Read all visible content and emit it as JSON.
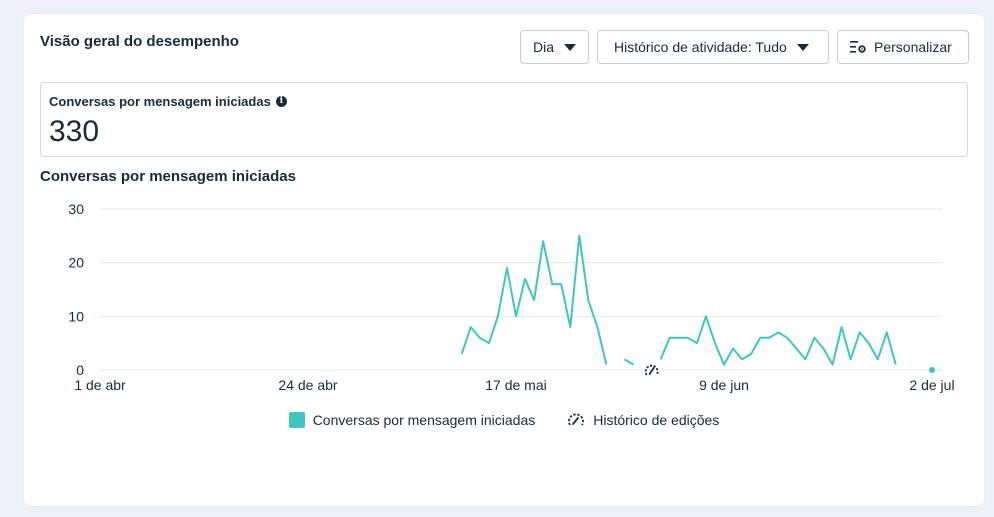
{
  "card": {
    "title": "Visão geral do desempenho",
    "period_select": "Dia",
    "history_select": "Histórico de atividade: Tudo",
    "customize_label": "Personalizar"
  },
  "metric": {
    "label": "Conversas por mensagem iniciadas",
    "value": "330"
  },
  "colors": {
    "series": "#3ec7c2",
    "grid": "#e4e6eb",
    "text": "#1c2b33"
  },
  "chart_data": {
    "type": "line",
    "title": "Conversas por mensagem iniciadas",
    "xlabel": "",
    "ylabel": "",
    "ylim": [
      0,
      30
    ],
    "yticks": [
      0,
      10,
      20,
      30
    ],
    "xlim": [
      "2024-04-01",
      "2024-07-02"
    ],
    "xticks": [
      {
        "date": "2024-04-01",
        "label": "1 de abr"
      },
      {
        "date": "2024-04-24",
        "label": "24 de abr"
      },
      {
        "date": "2024-05-17",
        "label": "17 de mai"
      },
      {
        "date": "2024-06-09",
        "label": "9 de jun"
      },
      {
        "date": "2024-07-02",
        "label": "2 de jul"
      }
    ],
    "grid": true,
    "legend_position": "bottom",
    "series": [
      {
        "name": "Conversas por mensagem iniciadas",
        "segments": [
          [
            [
              "2024-05-11",
              3
            ],
            [
              "2024-05-12",
              8
            ],
            [
              "2024-05-13",
              6
            ],
            [
              "2024-05-14",
              5
            ],
            [
              "2024-05-15",
              10
            ],
            [
              "2024-05-16",
              19
            ],
            [
              "2024-05-17",
              10
            ],
            [
              "2024-05-18",
              17
            ],
            [
              "2024-05-19",
              13
            ],
            [
              "2024-05-20",
              24
            ],
            [
              "2024-05-21",
              16
            ],
            [
              "2024-05-22",
              16
            ],
            [
              "2024-05-23",
              8
            ],
            [
              "2024-05-24",
              25
            ],
            [
              "2024-05-25",
              13
            ],
            [
              "2024-05-26",
              8
            ],
            [
              "2024-05-27",
              1
            ]
          ],
          [
            [
              "2024-05-29",
              2
            ],
            [
              "2024-05-30",
              1
            ]
          ],
          [
            [
              "2024-06-02",
              2
            ],
            [
              "2024-06-03",
              6
            ],
            [
              "2024-06-04",
              6
            ],
            [
              "2024-06-05",
              6
            ],
            [
              "2024-06-06",
              5
            ],
            [
              "2024-06-07",
              10
            ],
            [
              "2024-06-08",
              5
            ],
            [
              "2024-06-09",
              1
            ],
            [
              "2024-06-10",
              4
            ],
            [
              "2024-06-11",
              2
            ],
            [
              "2024-06-12",
              3
            ],
            [
              "2024-06-13",
              6
            ],
            [
              "2024-06-14",
              6
            ],
            [
              "2024-06-15",
              7
            ],
            [
              "2024-06-16",
              6
            ],
            [
              "2024-06-17",
              4
            ],
            [
              "2024-06-18",
              2
            ],
            [
              "2024-06-19",
              6
            ],
            [
              "2024-06-20",
              4
            ],
            [
              "2024-06-21",
              1
            ],
            [
              "2024-06-22",
              8
            ],
            [
              "2024-06-23",
              2
            ],
            [
              "2024-06-24",
              7
            ],
            [
              "2024-06-25",
              5
            ],
            [
              "2024-06-26",
              2
            ],
            [
              "2024-06-27",
              7
            ],
            [
              "2024-06-28",
              1
            ]
          ],
          [
            [
              "2024-07-02",
              0
            ]
          ]
        ]
      }
    ],
    "annotations": [
      {
        "date": "2024-06-01",
        "type": "edit-history-icon"
      }
    ],
    "legend": [
      {
        "label": "Conversas por mensagem iniciadas",
        "icon": "teal-square"
      },
      {
        "label": "Histórico de edições",
        "icon": "edit-history-icon"
      }
    ]
  }
}
